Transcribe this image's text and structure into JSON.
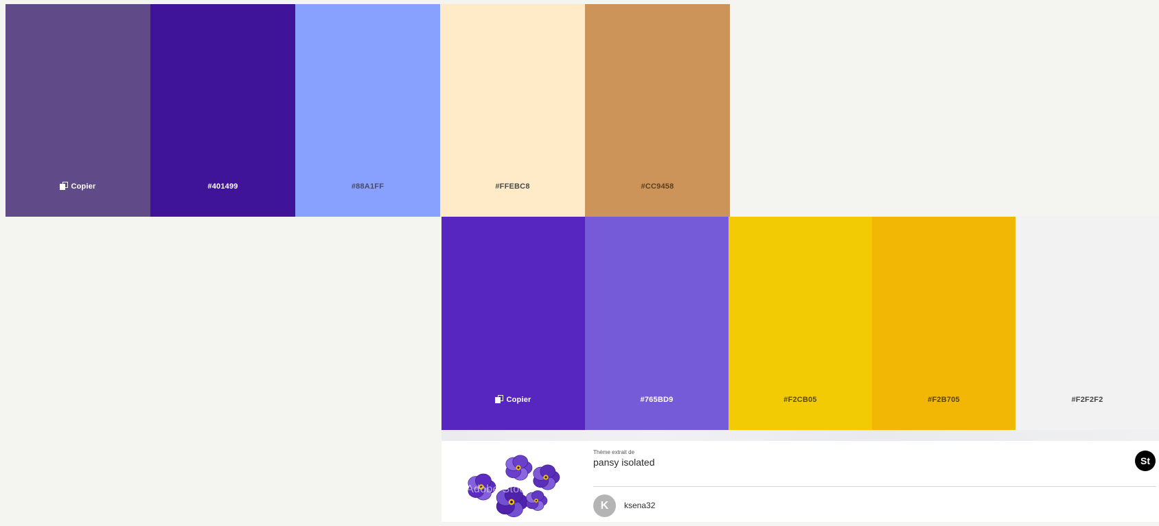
{
  "palettes": [
    {
      "swatches": [
        {
          "hex": "#614A88",
          "label": "Copier",
          "label_color": "#ffffff",
          "hover": true
        },
        {
          "hex": "#401499",
          "label": "#401499",
          "label_color": "#ffffff",
          "hover": false
        },
        {
          "hex": "#88A1FF",
          "label": "#88A1FF",
          "label_color": "#4a4a66",
          "hover": false
        },
        {
          "hex": "#FFEBC8",
          "label": "#FFEBC8",
          "label_color": "#4a4a4a",
          "hover": false
        },
        {
          "hex": "#CC9458",
          "label": "#CC9458",
          "label_color": "#5a4020",
          "hover": false
        }
      ]
    },
    {
      "swatches": [
        {
          "hex": "#5726C1",
          "label": "Copier",
          "label_color": "#ffffff",
          "hover": true
        },
        {
          "hex": "#765BD9",
          "label": "#765BD9",
          "label_color": "#ffffff",
          "hover": false
        },
        {
          "hex": "#F2CB05",
          "label": "#F2CB05",
          "label_color": "#5a4a00",
          "hover": false
        },
        {
          "hex": "#F2B705",
          "label": "#F2B705",
          "label_color": "#5a4200",
          "hover": false
        },
        {
          "hex": "#F2F2F2",
          "label": "#F2F2F2",
          "label_color": "#444444",
          "hover": false
        }
      ]
    }
  ],
  "info": {
    "caption": "Thème extrait de",
    "title": "pansy isolated",
    "badge": "St",
    "watermark": "Adobe Stock",
    "author_initial": "K",
    "author": "ksena32"
  }
}
